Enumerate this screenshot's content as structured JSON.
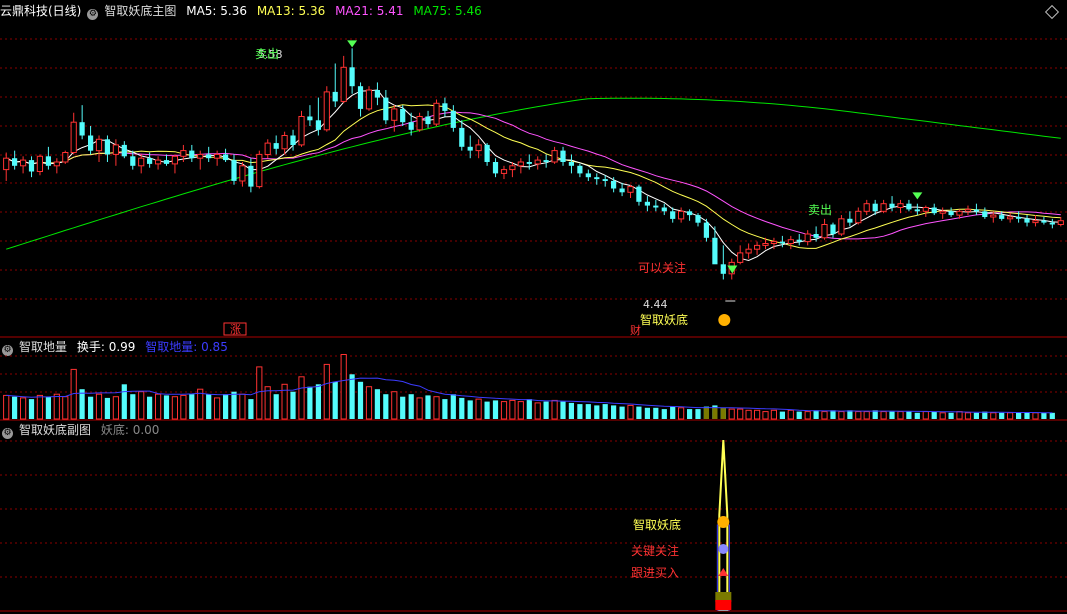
{
  "colors": {
    "up": "#ff3232",
    "down": "#54fcfc",
    "ma5": "#ffffff",
    "ma13": "#ffff54",
    "ma21": "#ff54ff",
    "ma75": "#00e600",
    "grid": "#8a0000",
    "divider": "#aa0000",
    "volma": "#3c3cff",
    "gold": "#ffff54",
    "green_label": "#54ff54",
    "red_label": "#ff3232"
  },
  "main_panel": {
    "stock_name": "云鼎科技(日线)",
    "indicator_name": "智取妖底主图",
    "ma5_label": "MA5: 5.36",
    "ma13_label": "MA13: 5.36",
    "ma21_label": "MA21: 5.41",
    "ma75_label": "MA75: 5.46",
    "high_marker": "5.58",
    "low_marker": "4.44",
    "sell_label_1": "卖出",
    "sell_label_2": "卖出",
    "buy_label": "可以关注",
    "bottom_signal": "智取妖底",
    "limit_tag": "涨",
    "cai_tag": "财"
  },
  "volume_panel": {
    "name": "智取地量",
    "turnover_label": "换手: 0.99",
    "dl_label": "智取地量: 0.85"
  },
  "sub_panel": {
    "name": "智取妖底副图",
    "value_label": "妖底: 0.00",
    "signal_1": "智取妖底",
    "signal_2": "关键关注",
    "signal_3": "跟进买入"
  },
  "chart_data": {
    "type": "candlestick",
    "ylim": [
      4.3,
      5.82
    ],
    "grid": true,
    "candles": [
      [
        5.02,
        5.11,
        4.96,
        5.08
      ],
      [
        5.08,
        5.12,
        5.02,
        5.04
      ],
      [
        5.04,
        5.09,
        5.0,
        5.07
      ],
      [
        5.07,
        5.09,
        4.98,
        5.01
      ],
      [
        5.01,
        5.1,
        4.99,
        5.09
      ],
      [
        5.09,
        5.14,
        5.02,
        5.04
      ],
      [
        5.04,
        5.08,
        5.0,
        5.06
      ],
      [
        5.06,
        5.12,
        5.05,
        5.11
      ],
      [
        5.11,
        5.32,
        5.1,
        5.27
      ],
      [
        5.27,
        5.36,
        5.18,
        5.2
      ],
      [
        5.2,
        5.25,
        5.1,
        5.12
      ],
      [
        5.12,
        5.2,
        5.06,
        5.18
      ],
      [
        5.18,
        5.2,
        5.06,
        5.1
      ],
      [
        5.1,
        5.18,
        5.04,
        5.15
      ],
      [
        5.15,
        5.17,
        5.08,
        5.09
      ],
      [
        5.09,
        5.12,
        5.02,
        5.04
      ],
      [
        5.04,
        5.1,
        5.0,
        5.08
      ],
      [
        5.08,
        5.11,
        5.03,
        5.05
      ],
      [
        5.05,
        5.09,
        5.02,
        5.07
      ],
      [
        5.07,
        5.1,
        5.04,
        5.05
      ],
      [
        5.05,
        5.1,
        5.0,
        5.09
      ],
      [
        5.09,
        5.15,
        5.06,
        5.12
      ],
      [
        5.12,
        5.15,
        5.06,
        5.08
      ],
      [
        5.08,
        5.12,
        5.02,
        5.1
      ],
      [
        5.1,
        5.14,
        5.06,
        5.08
      ],
      [
        5.08,
        5.12,
        5.04,
        5.1
      ],
      [
        5.1,
        5.13,
        5.06,
        5.07
      ],
      [
        5.07,
        5.1,
        4.94,
        4.96
      ],
      [
        4.96,
        5.06,
        4.93,
        5.04
      ],
      [
        5.04,
        5.08,
        4.9,
        4.93
      ],
      [
        4.93,
        5.12,
        4.92,
        5.1
      ],
      [
        5.1,
        5.18,
        5.08,
        5.16
      ],
      [
        5.16,
        5.2,
        5.1,
        5.13
      ],
      [
        5.13,
        5.22,
        5.1,
        5.2
      ],
      [
        5.2,
        5.23,
        5.12,
        5.15
      ],
      [
        5.15,
        5.33,
        5.14,
        5.3
      ],
      [
        5.3,
        5.36,
        5.25,
        5.28
      ],
      [
        5.28,
        5.4,
        5.2,
        5.23
      ],
      [
        5.23,
        5.46,
        5.22,
        5.43
      ],
      [
        5.43,
        5.58,
        5.35,
        5.38
      ],
      [
        5.38,
        5.62,
        5.37,
        5.56
      ],
      [
        5.56,
        5.66,
        5.42,
        5.46
      ],
      [
        5.46,
        5.48,
        5.3,
        5.34
      ],
      [
        5.34,
        5.46,
        5.33,
        5.44
      ],
      [
        5.44,
        5.48,
        5.36,
        5.4
      ],
      [
        5.4,
        5.44,
        5.26,
        5.28
      ],
      [
        5.28,
        5.36,
        5.22,
        5.34
      ],
      [
        5.34,
        5.36,
        5.25,
        5.27
      ],
      [
        5.27,
        5.32,
        5.2,
        5.23
      ],
      [
        5.23,
        5.32,
        5.22,
        5.3
      ],
      [
        5.3,
        5.33,
        5.24,
        5.26
      ],
      [
        5.26,
        5.39,
        5.25,
        5.37
      ],
      [
        5.37,
        5.4,
        5.3,
        5.33
      ],
      [
        5.33,
        5.36,
        5.22,
        5.24
      ],
      [
        5.24,
        5.28,
        5.12,
        5.14
      ],
      [
        5.14,
        5.2,
        5.08,
        5.12
      ],
      [
        5.12,
        5.18,
        5.08,
        5.15
      ],
      [
        5.15,
        5.16,
        5.04,
        5.06
      ],
      [
        5.06,
        5.08,
        4.98,
        5.0
      ],
      [
        5.0,
        5.04,
        4.97,
        5.02
      ],
      [
        5.02,
        5.06,
        4.98,
        5.04
      ],
      [
        5.04,
        5.08,
        5.0,
        5.06
      ],
      [
        5.06,
        5.1,
        5.02,
        5.05
      ],
      [
        5.05,
        5.09,
        5.02,
        5.07
      ],
      [
        5.07,
        5.1,
        5.03,
        5.06
      ],
      [
        5.06,
        5.14,
        5.05,
        5.12
      ],
      [
        5.12,
        5.14,
        5.04,
        5.06
      ],
      [
        5.06,
        5.1,
        5.0,
        5.04
      ],
      [
        5.04,
        5.05,
        4.98,
        5.0
      ],
      [
        5.0,
        5.02,
        4.96,
        4.98
      ],
      [
        4.98,
        5.0,
        4.94,
        4.97
      ],
      [
        4.97,
        4.99,
        4.93,
        4.96
      ],
      [
        4.96,
        4.98,
        4.9,
        4.92
      ],
      [
        4.92,
        4.95,
        4.88,
        4.9
      ],
      [
        4.9,
        4.94,
        4.87,
        4.93
      ],
      [
        4.93,
        4.94,
        4.83,
        4.85
      ],
      [
        4.85,
        4.88,
        4.8,
        4.83
      ],
      [
        4.83,
        4.86,
        4.8,
        4.82
      ],
      [
        4.82,
        4.84,
        4.78,
        4.8
      ],
      [
        4.8,
        4.82,
        4.74,
        4.76
      ],
      [
        4.76,
        4.82,
        4.74,
        4.8
      ],
      [
        4.8,
        4.81,
        4.75,
        4.78
      ],
      [
        4.78,
        4.79,
        4.72,
        4.74
      ],
      [
        4.74,
        4.76,
        4.64,
        4.66
      ],
      [
        4.66,
        4.72,
        4.6,
        4.52
      ],
      [
        4.52,
        4.62,
        4.44,
        4.47
      ],
      [
        4.47,
        4.55,
        4.44,
        4.53
      ],
      [
        4.53,
        4.62,
        4.52,
        4.58
      ],
      [
        4.58,
        4.63,
        4.55,
        4.6
      ],
      [
        4.6,
        4.64,
        4.57,
        4.62
      ],
      [
        4.62,
        4.66,
        4.6,
        4.63
      ],
      [
        4.63,
        4.66,
        4.6,
        4.64
      ],
      [
        4.64,
        4.67,
        4.61,
        4.63
      ],
      [
        4.63,
        4.67,
        4.6,
        4.65
      ],
      [
        4.65,
        4.68,
        4.62,
        4.64
      ],
      [
        4.64,
        4.7,
        4.62,
        4.68
      ],
      [
        4.68,
        4.72,
        4.64,
        4.66
      ],
      [
        4.66,
        4.76,
        4.65,
        4.73
      ],
      [
        4.73,
        4.74,
        4.66,
        4.68
      ],
      [
        4.68,
        4.78,
        4.67,
        4.76
      ],
      [
        4.76,
        4.8,
        4.72,
        4.74
      ],
      [
        4.74,
        4.82,
        4.73,
        4.8
      ],
      [
        4.8,
        4.86,
        4.78,
        4.84
      ],
      [
        4.84,
        4.86,
        4.78,
        4.8
      ],
      [
        4.8,
        4.86,
        4.79,
        4.84
      ],
      [
        4.84,
        4.88,
        4.8,
        4.82
      ],
      [
        4.82,
        4.86,
        4.79,
        4.84
      ],
      [
        4.84,
        4.86,
        4.8,
        4.81
      ],
      [
        4.81,
        4.84,
        4.78,
        4.8
      ],
      [
        4.8,
        4.83,
        4.77,
        4.82
      ],
      [
        4.82,
        4.84,
        4.78,
        4.79
      ],
      [
        4.79,
        4.82,
        4.76,
        4.8
      ],
      [
        4.8,
        4.82,
        4.77,
        4.78
      ],
      [
        4.78,
        4.81,
        4.76,
        4.8
      ],
      [
        4.8,
        4.83,
        4.78,
        4.81
      ],
      [
        4.81,
        4.84,
        4.78,
        4.8
      ],
      [
        4.8,
        4.82,
        4.76,
        4.77
      ],
      [
        4.77,
        4.8,
        4.74,
        4.78
      ],
      [
        4.78,
        4.8,
        4.75,
        4.76
      ],
      [
        4.76,
        4.79,
        4.74,
        4.77
      ],
      [
        4.77,
        4.8,
        4.74,
        4.76
      ],
      [
        4.76,
        4.78,
        4.72,
        4.74
      ],
      [
        4.74,
        4.78,
        4.72,
        4.75
      ],
      [
        4.75,
        4.77,
        4.73,
        4.74
      ],
      [
        4.74,
        4.76,
        4.71,
        4.73
      ],
      [
        4.73,
        4.77,
        4.72,
        4.75
      ]
    ],
    "volume": [
      0.95,
      0.9,
      0.85,
      0.8,
      0.95,
      0.9,
      1.0,
      0.9,
      2.0,
      1.2,
      0.9,
      1.0,
      0.85,
      0.9,
      1.4,
      1.0,
      1.1,
      0.9,
      1.0,
      0.95,
      0.9,
      0.95,
      1.0,
      1.2,
      1.0,
      0.85,
      1.0,
      1.1,
      1.0,
      0.8,
      2.1,
      1.3,
      1.0,
      1.4,
      1.1,
      1.7,
      1.3,
      1.4,
      2.2,
      1.5,
      2.6,
      1.8,
      1.5,
      1.3,
      1.2,
      1.0,
      1.1,
      0.9,
      1.0,
      0.85,
      0.95,
      0.9,
      0.8,
      1.0,
      0.85,
      0.75,
      0.8,
      0.7,
      0.75,
      0.7,
      0.75,
      0.7,
      0.8,
      0.65,
      0.7,
      0.75,
      0.7,
      0.65,
      0.6,
      0.6,
      0.55,
      0.6,
      0.55,
      0.5,
      0.55,
      0.5,
      0.45,
      0.45,
      0.4,
      0.5,
      0.45,
      0.4,
      0.4,
      0.5,
      0.55,
      0.45,
      0.4,
      0.4,
      0.35,
      0.35,
      0.3,
      0.35,
      0.3,
      0.35,
      0.3,
      0.3,
      0.35,
      0.3,
      0.35,
      0.3,
      0.35,
      0.3,
      0.3,
      0.35,
      0.3,
      0.3,
      0.3,
      0.3,
      0.25,
      0.3,
      0.3,
      0.25,
      0.25,
      0.3,
      0.25,
      0.25,
      0.3,
      0.25,
      0.25,
      0.25,
      0.25,
      0.25,
      0.25,
      0.25,
      0.25
    ]
  }
}
